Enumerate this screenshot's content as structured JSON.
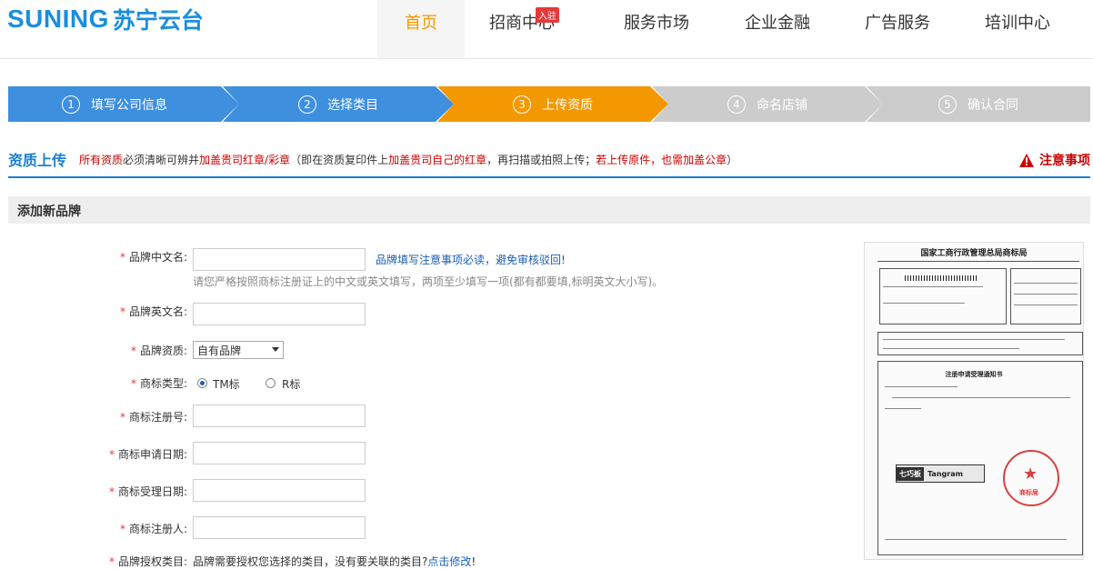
{
  "header": {
    "logo_en": "SUNING",
    "logo_cn": "苏宁云台",
    "nav": [
      {
        "label": "首页"
      },
      {
        "label": "招商中心",
        "badge": "入驻"
      },
      {
        "label": "服务市场"
      },
      {
        "label": "企业金融"
      },
      {
        "label": "广告服务"
      },
      {
        "label": "培训中心"
      }
    ]
  },
  "steps": [
    {
      "num": "1",
      "label": "填写公司信息",
      "state": "done"
    },
    {
      "num": "2",
      "label": "选择类目",
      "state": "done"
    },
    {
      "num": "3",
      "label": "上传资质",
      "state": "current"
    },
    {
      "num": "4",
      "label": "命名店铺",
      "state": "todo"
    },
    {
      "num": "5",
      "label": "确认合同",
      "state": "todo"
    }
  ],
  "colors": {
    "done": "#3e8fde",
    "current": "#f39800",
    "todo": "#cccccc",
    "accent": "#1a7fd0"
  },
  "qualification": {
    "title": "资质上传",
    "desc_1": "所有资质",
    "desc_2": "必须清晰可辨并",
    "desc_3": "加盖贵司红章/彩章",
    "desc_4": "（即在资质复印件上",
    "desc_5": "加盖贵司自己的红章",
    "desc_6": "，再扫描或拍照上传；",
    "desc_7": "若上传原件，也需加盖公章",
    "desc_8": "）",
    "notice": "注意事项"
  },
  "add_brand": {
    "title": "添加新品牌"
  },
  "form": {
    "brand_cn": {
      "label": "品牌中文名:",
      "value": ""
    },
    "brand_cn_link": "品牌填写注意事项必读，避免审核驳回!",
    "brand_hint": "请您严格按照商标注册证上的中文或英文填写，两项至少填写一项(都有都要填,标明英文大小写)。",
    "brand_en": {
      "label": "品牌英文名:",
      "value": ""
    },
    "qualification": {
      "label": "品牌资质:",
      "selected": "自有品牌"
    },
    "mark_type": {
      "label": "商标类型:",
      "options": [
        "TM标",
        "R标"
      ],
      "selected": "TM标"
    },
    "reg_no": {
      "label": "商标注册号:",
      "value": ""
    },
    "apply_date": {
      "label": "商标申请日期:",
      "value": ""
    },
    "accept_date": {
      "label": "商标受理日期:",
      "value": ""
    },
    "registrant": {
      "label": "商标注册人:",
      "value": ""
    },
    "auth_category": {
      "label": "品牌授权类目:",
      "text": "品牌需要授权您选择的类目，没有要关联的类目?",
      "link": "点击修改",
      "tail": "!"
    }
  },
  "certificate": {
    "title": "国家工商行政管理总局商标局",
    "notice_title": "注册申请受理通知书",
    "tangram": [
      "七巧板",
      "Tangram"
    ],
    "stamp": "商标局"
  }
}
